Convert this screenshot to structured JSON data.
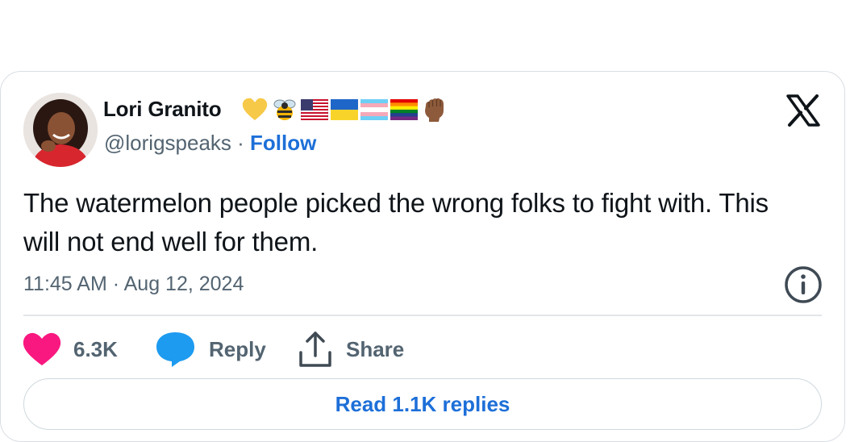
{
  "author": {
    "display_name": "Lori Granito",
    "handle": "@lorigspeaks",
    "separator": " · ",
    "follow_label": "Follow",
    "badges": [
      "yellow-heart-emoji",
      "bee-emoji",
      "us-flag-emoji",
      "ukraine-flag-emoji",
      "transgender-flag-emoji",
      "rainbow-flag-emoji",
      "raised-fist-emoji"
    ]
  },
  "tweet": {
    "text": "The watermelon people picked the wrong folks to fight with. This will not end well for them.",
    "timestamp": "11:45 AM · Aug 12, 2024"
  },
  "actions": {
    "likes_count": "6.3K",
    "reply_label": "Reply",
    "share_label": "Share"
  },
  "read_replies_label": "Read 1.1K replies",
  "colors": {
    "like": "#f91880",
    "reply": "#1d9bf0",
    "link": "#1d6fd8",
    "muted": "#536471"
  }
}
